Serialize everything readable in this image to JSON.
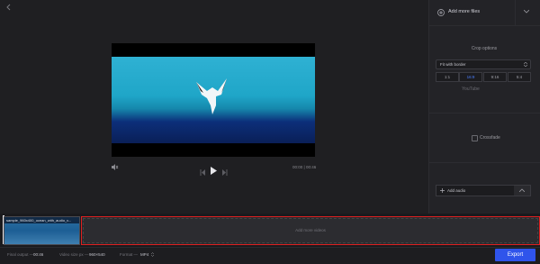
{
  "header": {
    "back_icon": "chevron-left-icon"
  },
  "player": {
    "current_time": "00:00",
    "separator": "|",
    "total_time": "00:46"
  },
  "panel": {
    "add_more_files": "Add more files",
    "crop_options": "Crop options",
    "fit_mode": "Fit with border",
    "ratios": [
      "1:1",
      "16:9",
      "9:16",
      "5:4"
    ],
    "active_ratio": "16:9",
    "ratio_caption": "YouTube",
    "crossfade": "Crossfade",
    "add_audio": "Add audio"
  },
  "timeline": {
    "clip_name": "sample_960x400_ocean_with_audio_v...",
    "drop_text": "Add more videos"
  },
  "bottom": {
    "duration_label": "Final output —",
    "duration_value": "00:46",
    "size_label": "Video size px —",
    "size_value": "960×540",
    "format_label": "Format —",
    "format_value": "MP4",
    "export_label": "Export"
  },
  "colors": {
    "accent": "#2f54eb",
    "highlight": "#e02020"
  }
}
